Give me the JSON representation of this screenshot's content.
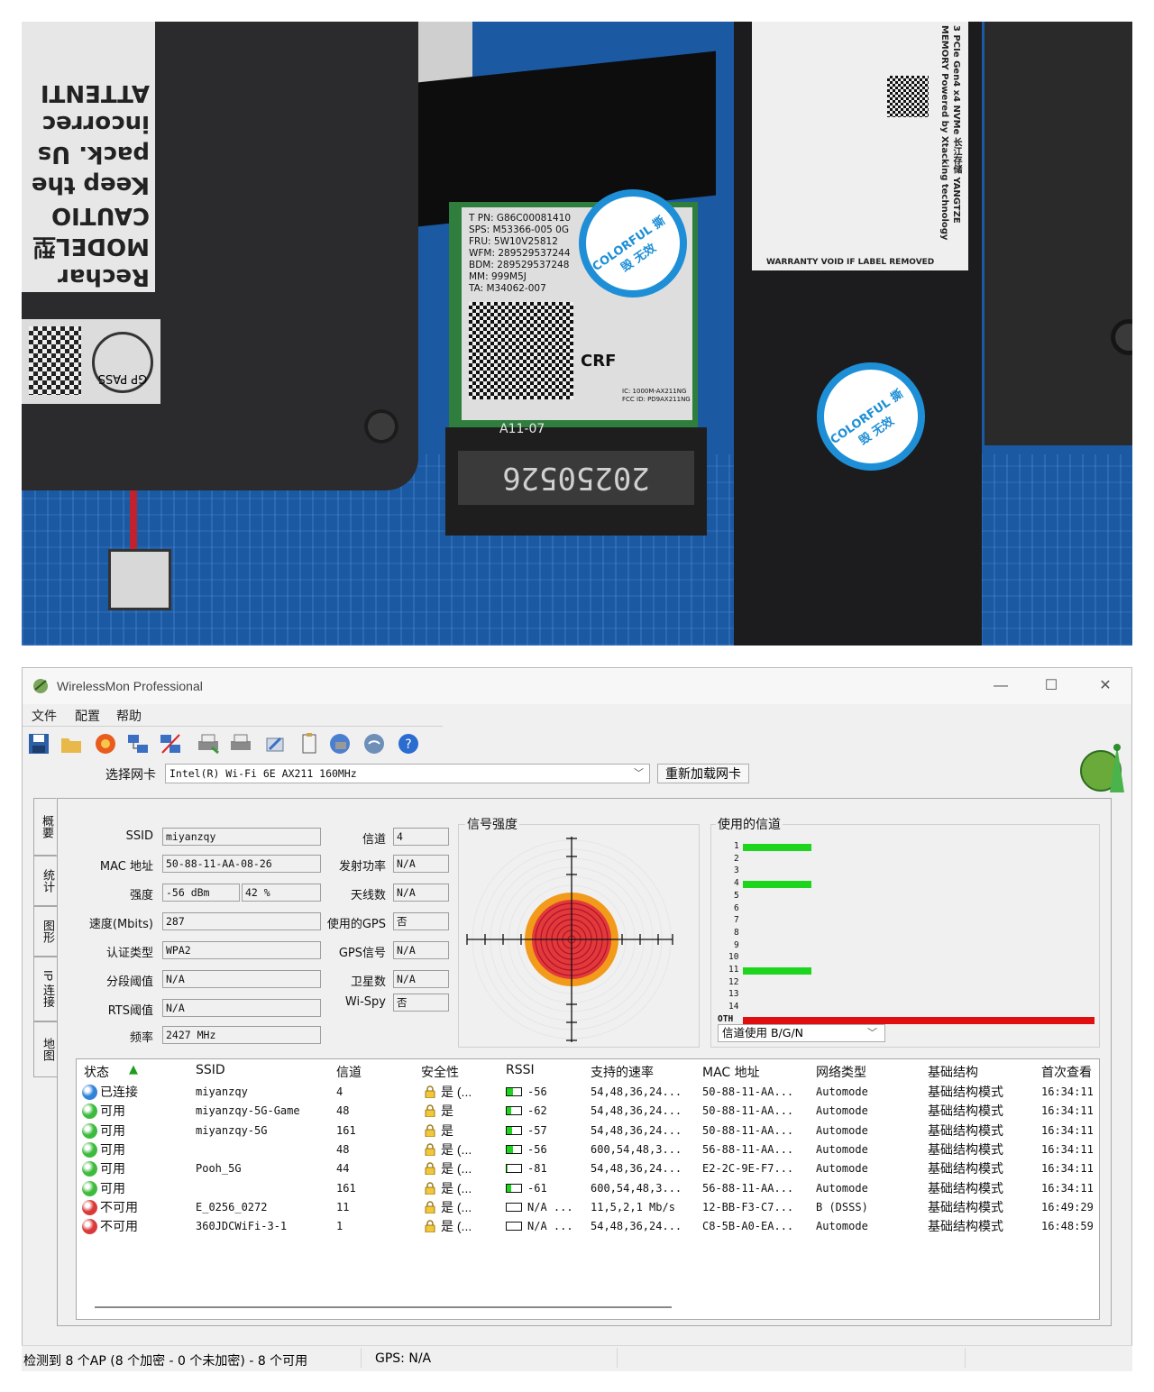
{
  "photo": {
    "battery_label_lines": [
      "Rechar",
      "MODEL型",
      "CAUTIO",
      "Keep the",
      "pack. Us",
      "incorrec",
      "ATTENTI"
    ],
    "gp_pass": "GP PASS",
    "wifi_card_lines": [
      "T PN: G86C00081410",
      "SPS: M53366-005  0G",
      "FRU: 5W10V25812",
      "WFM: 289529537244",
      "BDM: 289529537248",
      "MM: 999M5J",
      "TA: M34062-007"
    ],
    "wifi_marks": [
      "CRF",
      "IC: 1000M-AX211NG",
      "FCC ID: PD9AX211NG"
    ],
    "slot_number": "20250526",
    "slot_label": "A11-07",
    "sticker_text": "COLORFUL 撕毁 无效",
    "ssd_label_text": "3 PCIe Gen4 x4 NVMe  长江存储 YANGTZE MEMORY Powered by Xtacking technology",
    "ssd_warranty": "WARRANTY VOID IF LABEL REMOVED"
  },
  "window": {
    "title": "WirelessMon Professional",
    "controls": {
      "minimize": "—",
      "maximize": "☐",
      "close": "✕"
    },
    "menu": [
      "文件",
      "配置",
      "帮助"
    ],
    "adapter_label": "选择网卡",
    "adapter_value": "Intel(R) Wi-Fi 6E AX211 160MHz",
    "reload_button": "重新加载网卡",
    "tabs": [
      "概要",
      "统计",
      "图形",
      "IP 连接",
      "地图"
    ],
    "fields_left": [
      {
        "label": "SSID",
        "value": "miyanzqy"
      },
      {
        "label": "MAC 地址",
        "value": "50-88-11-AA-08-26"
      },
      {
        "label": "强度",
        "value": "-56 dBm",
        "value2": "42 %"
      },
      {
        "label": "速度(Mbits)",
        "value": "287"
      },
      {
        "label": "认证类型",
        "value": "WPA2"
      },
      {
        "label": "分段阈值",
        "value": "N/A"
      },
      {
        "label": "RTS阈值",
        "value": "N/A"
      },
      {
        "label": "频率",
        "value": "2427 MHz"
      }
    ],
    "fields_mid": [
      {
        "label": "信道",
        "value": "4"
      },
      {
        "label": "发射功率",
        "value": "N/A"
      },
      {
        "label": "天线数",
        "value": "N/A"
      },
      {
        "label": "使用的GPS",
        "value": "否"
      },
      {
        "label": "GPS信号",
        "value": "N/A"
      },
      {
        "label": "卫星数",
        "value": "N/A"
      },
      {
        "label": "Wi-Spy",
        "value": "否"
      }
    ],
    "signal_group_title": "信号强度",
    "channel_group_title": "使用的信道",
    "channel_labels": [
      "1",
      "2",
      "3",
      "4",
      "5",
      "6",
      "7",
      "8",
      "9",
      "10",
      "11",
      "12",
      "13",
      "14",
      "OTH"
    ],
    "channel_usage": [
      1,
      0,
      0,
      1,
      0,
      0,
      0,
      0,
      0,
      0,
      1,
      0,
      0,
      0,
      5
    ],
    "channel_filter": "信道使用 B/G/N",
    "table": {
      "headers": [
        "状态",
        "SSID",
        "信道",
        "安全性",
        "RSSI",
        "支持的速率",
        "MAC 地址",
        "网络类型",
        "基础结构",
        "首次查看"
      ],
      "rows": [
        {
          "status": "已连接",
          "state": "connected",
          "ssid": "miyanzqy",
          "channel": "4",
          "security": "是 (...",
          "rssi": "-56",
          "rssi_level": 0.42,
          "rates": "54,48,36,24...",
          "mac": "50-88-11-AA...",
          "nettype": "Automode",
          "infra": "基础结构模式",
          "first": "16:34:11"
        },
        {
          "status": "可用",
          "state": "available",
          "ssid": "miyanzqy-5G-Game",
          "channel": "48",
          "security": "是",
          "rssi": "-62",
          "rssi_level": 0.3,
          "rates": "54,48,36,24...",
          "mac": "50-88-11-AA...",
          "nettype": "Automode",
          "infra": "基础结构模式",
          "first": "16:34:11"
        },
        {
          "status": "可用",
          "state": "available",
          "ssid": "miyanzqy-5G",
          "channel": "161",
          "security": "是",
          "rssi": "-57",
          "rssi_level": 0.4,
          "rates": "54,48,36,24...",
          "mac": "50-88-11-AA...",
          "nettype": "Automode",
          "infra": "基础结构模式",
          "first": "16:34:11"
        },
        {
          "status": "可用",
          "state": "available",
          "ssid": "",
          "channel": "48",
          "security": "是 (...",
          "rssi": "-56",
          "rssi_level": 0.42,
          "rates": "600,54,48,3...",
          "mac": "56-88-11-AA...",
          "nettype": "Automode",
          "infra": "基础结构模式",
          "first": "16:34:11"
        },
        {
          "status": "可用",
          "state": "available",
          "ssid": "Pooh_5G",
          "channel": "44",
          "security": "是 (...",
          "rssi": "-81",
          "rssi_level": 0.08,
          "rates": "54,48,36,24...",
          "mac": "E2-2C-9E-F7...",
          "nettype": "Automode",
          "infra": "基础结构模式",
          "first": "16:34:11"
        },
        {
          "status": "可用",
          "state": "available",
          "ssid": "",
          "channel": "161",
          "security": "是 (...",
          "rssi": "-61",
          "rssi_level": 0.32,
          "rates": "600,54,48,3...",
          "mac": "56-88-11-AA...",
          "nettype": "Automode",
          "infra": "基础结构模式",
          "first": "16:34:11"
        },
        {
          "status": "不可用",
          "state": "unavailable",
          "ssid": "E_0256_0272",
          "channel": "11",
          "security": "是 (...",
          "rssi": "N/A ...",
          "rssi_level": 0,
          "rates": "11,5,2,1 Mb/s",
          "mac": "12-BB-F3-C7...",
          "nettype": "B (DSSS)",
          "infra": "基础结构模式",
          "first": "16:49:29"
        },
        {
          "status": "不可用",
          "state": "unavailable",
          "ssid": "360JDCWiFi-3-1",
          "channel": "1",
          "security": "是 (...",
          "rssi": "N/A ...",
          "rssi_level": 0,
          "rates": "54,48,36,24...",
          "mac": "C8-5B-A0-EA...",
          "nettype": "Automode",
          "infra": "基础结构模式",
          "first": "16:48:59"
        }
      ]
    },
    "status_bar": {
      "ap_summary": "检测到 8 个AP (8 个加密 - 0 个未加密) - 8 个可用",
      "gps": "GPS: N/A"
    },
    "colors": {
      "connected": "#2f83d9",
      "available": "#3dbb3d",
      "unavailable": "#d83a3a",
      "bar_green": "#1ed51e",
      "bar_red": "#e01010"
    }
  }
}
